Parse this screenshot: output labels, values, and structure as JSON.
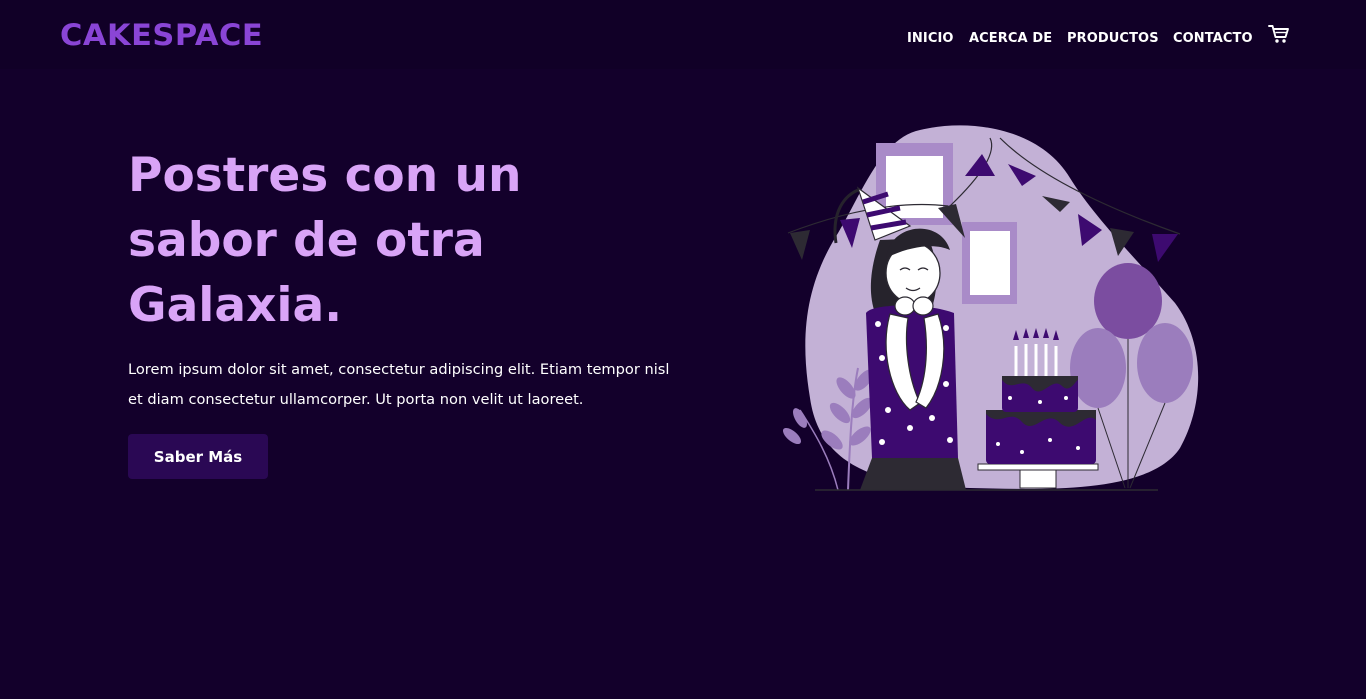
{
  "brand": {
    "name": "CAKESPACE"
  },
  "nav": {
    "items": [
      {
        "label": "INICIO"
      },
      {
        "label": "ACERCA DE"
      },
      {
        "label": "PRODUCTOS"
      },
      {
        "label": "CONTACTO"
      }
    ],
    "cart_icon": "shopping-cart-icon"
  },
  "hero": {
    "title": "Postres con un sabor de otra Galaxia.",
    "description": "Lorem ipsum dolor sit amet, consectetur adipiscing elit. Etiam tempor nisl et diam consectetur ullamcorper. Ut porta non velit ut laoreet.",
    "button_label": "Saber Más"
  },
  "colors": {
    "background": "#13002b",
    "navbar": "#110027",
    "logo": "#8a45d6",
    "title": "#d9a4f7",
    "button": "#2a0854",
    "illustration_blob": "#c3b1d6",
    "accent_purple": "#3d0a70"
  }
}
